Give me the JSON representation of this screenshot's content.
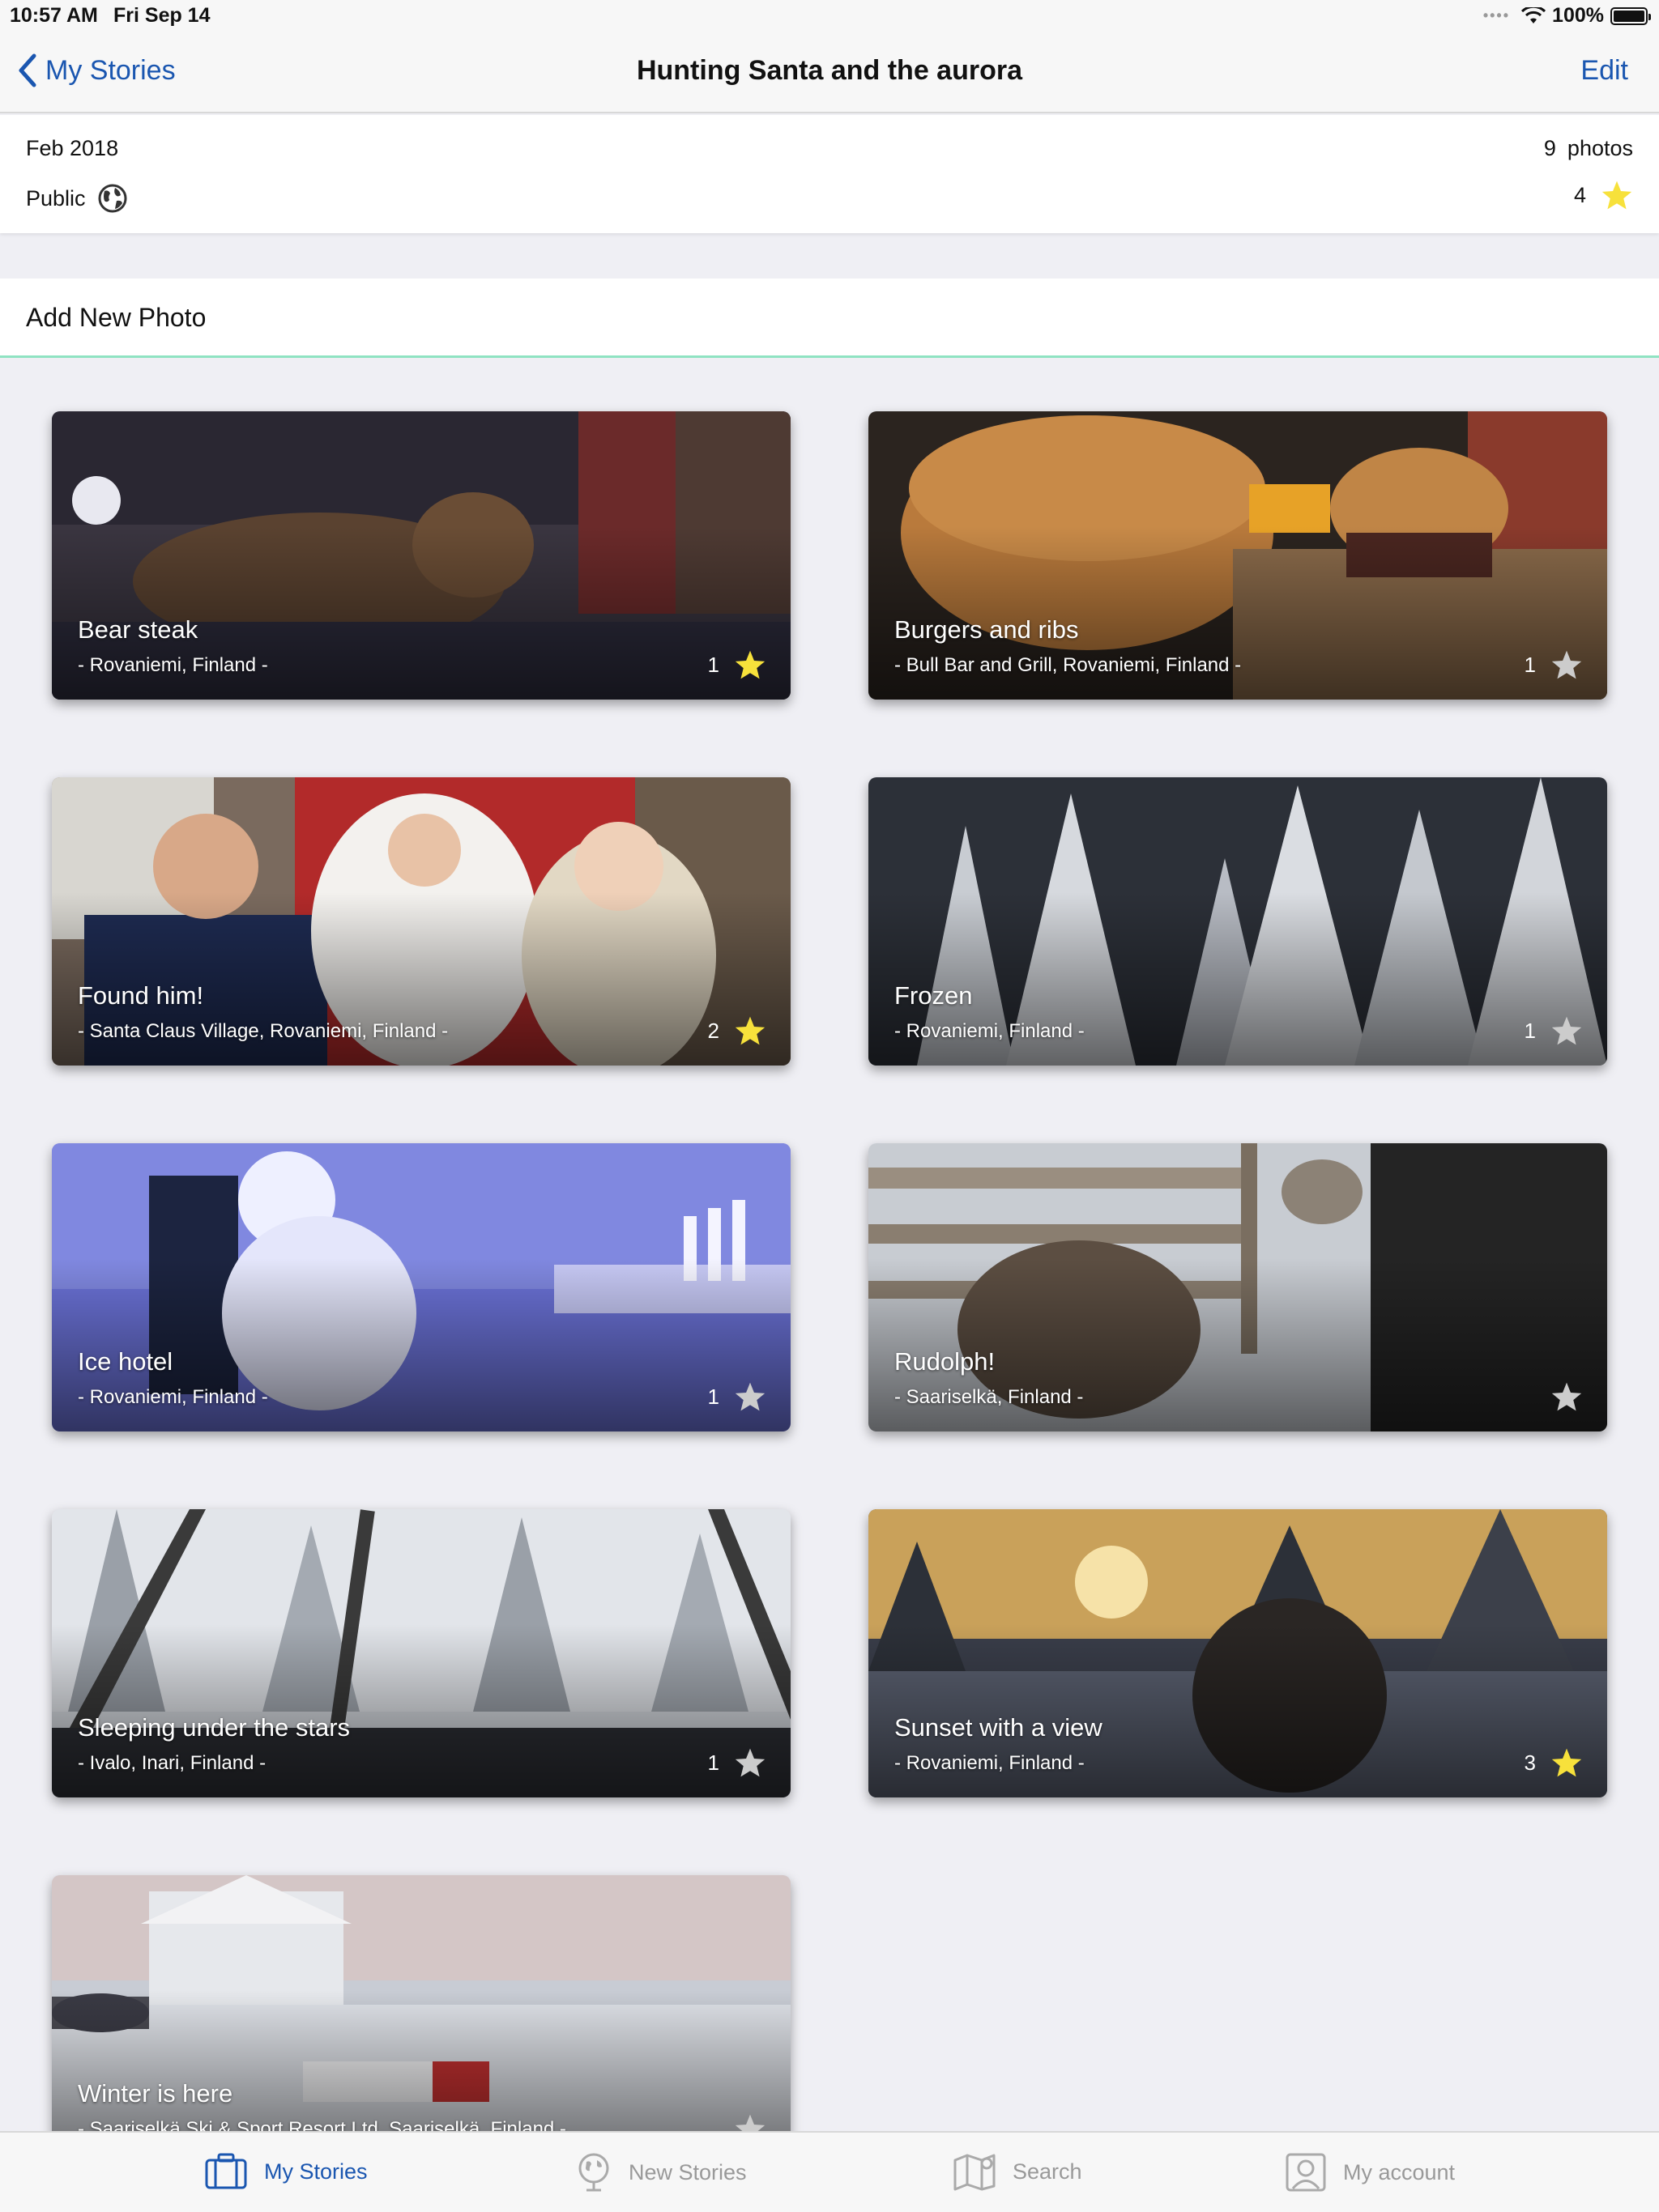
{
  "status_bar": {
    "time": "10:57 AM",
    "date": "Fri Sep 14",
    "battery": "100%"
  },
  "nav": {
    "back_label": "My Stories",
    "title": "Hunting Santa and the aurora",
    "edit_label": "Edit"
  },
  "story": {
    "date": "Feb 2018",
    "visibility": "Public",
    "photo_count": "9",
    "photo_label": "photos",
    "star_count": "4"
  },
  "add_photo_label": "Add New Photo",
  "colors": {
    "accent": "#1a56b0",
    "star_active": "#f7e13b",
    "star_inactive": "#cccccc",
    "divider": "#8fe3c2"
  },
  "photos": [
    {
      "title": "Bear steak",
      "location": "- Rovaniemi, Finland -",
      "rating": "1",
      "starred": true
    },
    {
      "title": "Burgers and ribs",
      "location": "- Bull Bar and Grill, Rovaniemi, Finland -",
      "rating": "1",
      "starred": false
    },
    {
      "title": "Found him!",
      "location": "- Santa Claus Village, Rovaniemi, Finland -",
      "rating": "2",
      "starred": true
    },
    {
      "title": "Frozen",
      "location": "- Rovaniemi, Finland -",
      "rating": "1",
      "starred": false
    },
    {
      "title": "Ice hotel",
      "location": "- Rovaniemi, Finland -",
      "rating": "1",
      "starred": false
    },
    {
      "title": "Rudolph!",
      "location": "- Saariselkä, Finland -",
      "rating": "",
      "starred": false
    },
    {
      "title": "Sleeping under the stars",
      "location": "- Ivalo, Inari, Finland -",
      "rating": "1",
      "starred": false
    },
    {
      "title": "Sunset with a view",
      "location": "- Rovaniemi, Finland -",
      "rating": "3",
      "starred": true
    },
    {
      "title": "Winter is here",
      "location": "- Saariselkä Ski & Sport Resort Ltd, Saariselkä, Finland -",
      "rating": "",
      "starred": false
    }
  ],
  "tabs": [
    {
      "label": "My Stories",
      "icon": "suitcase-icon",
      "active": true
    },
    {
      "label": "New Stories",
      "icon": "globe-icon",
      "active": false
    },
    {
      "label": "Search",
      "icon": "map-icon",
      "active": false
    },
    {
      "label": "My account",
      "icon": "user-icon",
      "active": false
    }
  ]
}
